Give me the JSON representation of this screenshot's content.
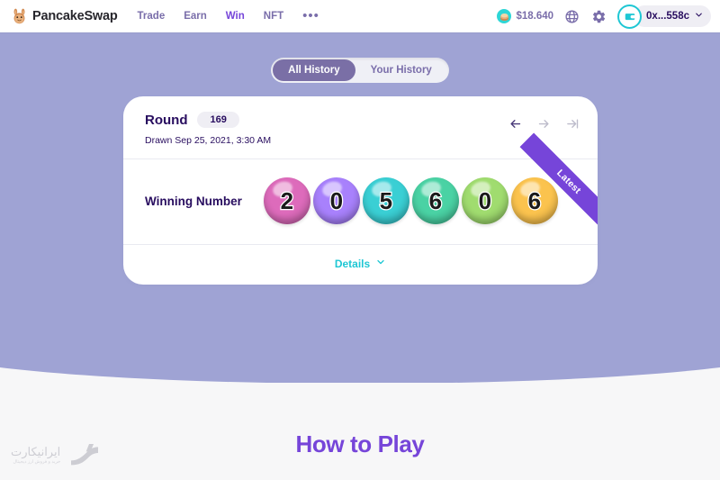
{
  "navbar": {
    "brand": "PancakeSwap",
    "brand_logo_icon": "pancake-bunny-icon",
    "links": [
      {
        "label": "Trade",
        "active": false
      },
      {
        "label": "Earn",
        "active": false
      },
      {
        "label": "Win",
        "active": true
      },
      {
        "label": "NFT",
        "active": false
      }
    ],
    "more_label": "•••",
    "price": "$18.640",
    "price_token_icon": "cake-token-icon",
    "globe_icon": "globe-icon",
    "settings_icon": "gear-icon",
    "wallet_icon": "wallet-icon",
    "wallet_address": "0x...558c",
    "wallet_chevron_icon": "chevron-down-icon"
  },
  "tabs": [
    {
      "label": "All History",
      "active": true
    },
    {
      "label": "Your History",
      "active": false
    }
  ],
  "round_card": {
    "round_label": "Round",
    "round_number": "169",
    "drawn_text": "Drawn Sep 25, 2021, 3:30 AM",
    "prev_arrow_icon": "arrow-left-icon",
    "next_arrow_icon": "arrow-right-icon",
    "last_arrow_icon": "arrow-to-last-icon",
    "winning_label": "Winning Number",
    "ribbon_label": "Latest",
    "details_label": "Details",
    "details_chevron_icon": "chevron-down-icon",
    "balls": [
      {
        "digit": "2",
        "color": "#DD6BBB"
      },
      {
        "digit": "0",
        "color": "#A881FC"
      },
      {
        "digit": "5",
        "color": "#3ACFD4"
      },
      {
        "digit": "6",
        "color": "#4AD2A4"
      },
      {
        "digit": "0",
        "color": "#A0DC6F"
      },
      {
        "digit": "6",
        "color": "#FBC34E"
      }
    ]
  },
  "footer": {
    "how_to_play_title": "How to Play"
  },
  "watermark": {
    "text": "ایرانیکارت",
    "subtext": "خرید و فروش ارز دیجیتال",
    "logo_icon": "iranicard-logo-icon"
  },
  "colors": {
    "background_top": "#9FA3D4",
    "background_bottom": "#F7F7F8",
    "accent_purple": "#7645D9",
    "accent_teal": "#1FC7D4",
    "text_dark": "#280D5F",
    "text_muted": "#7A6EAA"
  }
}
